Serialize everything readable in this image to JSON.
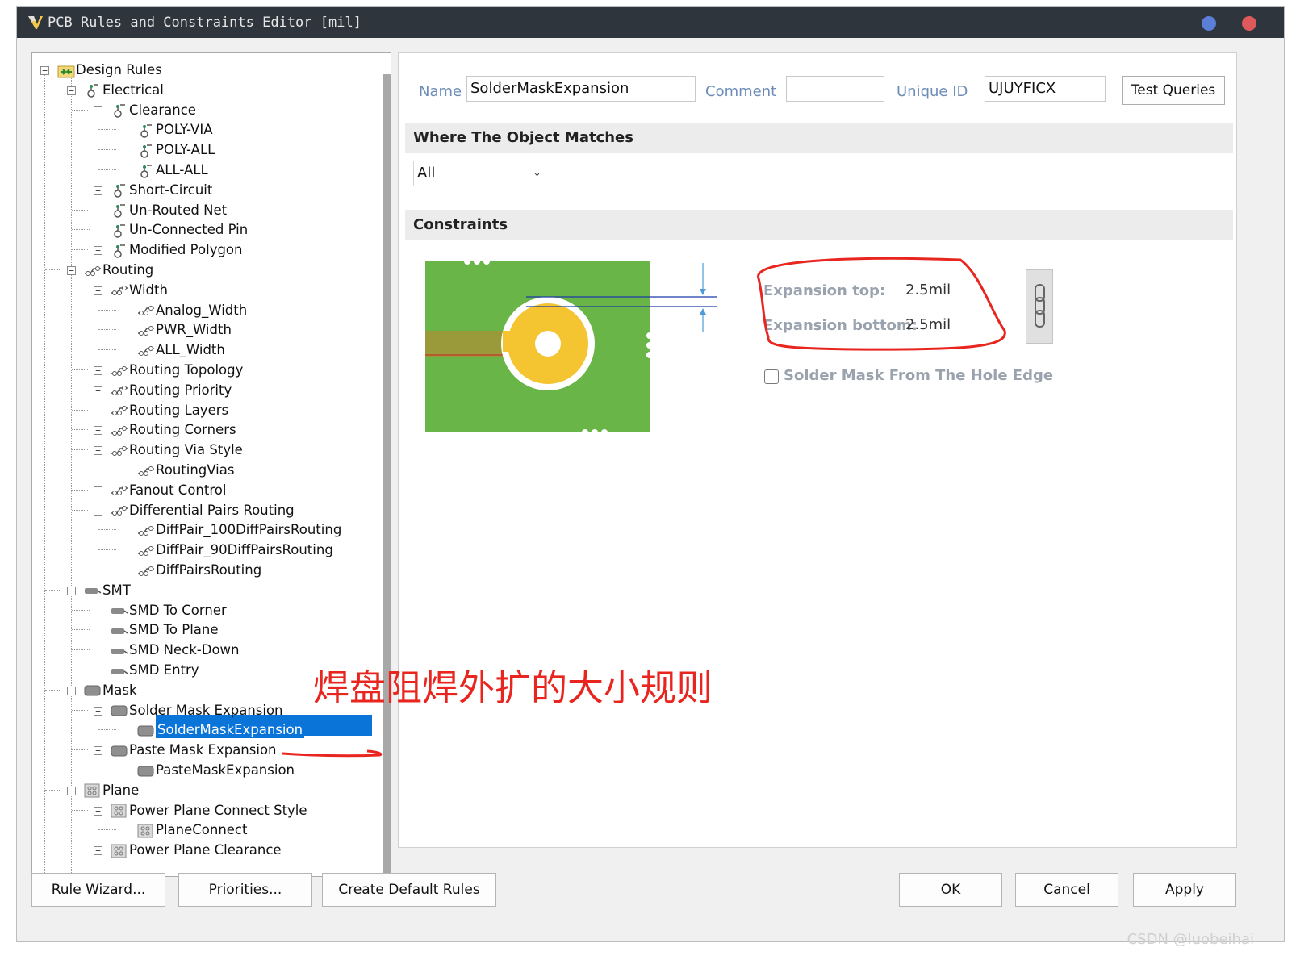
{
  "window": {
    "title": "PCB Rules and Constraints Editor [mil]"
  },
  "tree": {
    "items": [
      {
        "label": "Design Rules",
        "level": 0,
        "toggle": "−",
        "icon": "design-rules-icon"
      },
      {
        "label": "Electrical",
        "level": 1,
        "toggle": "−",
        "icon": "electrical-icon"
      },
      {
        "label": "Clearance",
        "level": 2,
        "toggle": "−",
        "icon": "clearance-icon"
      },
      {
        "label": "POLY-VIA",
        "level": 3,
        "toggle": "",
        "icon": "clearance-icon"
      },
      {
        "label": "POLY-ALL",
        "level": 3,
        "toggle": "",
        "icon": "clearance-icon"
      },
      {
        "label": "ALL-ALL",
        "level": 3,
        "toggle": "",
        "icon": "clearance-icon"
      },
      {
        "label": "Short-Circuit",
        "level": 2,
        "toggle": "+",
        "icon": "clearance-icon"
      },
      {
        "label": "Un-Routed Net",
        "level": 2,
        "toggle": "+",
        "icon": "clearance-icon"
      },
      {
        "label": "Un-Connected Pin",
        "level": 2,
        "toggle": "",
        "icon": "clearance-icon"
      },
      {
        "label": "Modified Polygon",
        "level": 2,
        "toggle": "+",
        "icon": "clearance-icon"
      },
      {
        "label": "Routing",
        "level": 1,
        "toggle": "−",
        "icon": "routing-icon"
      },
      {
        "label": "Width",
        "level": 2,
        "toggle": "−",
        "icon": "routing-icon"
      },
      {
        "label": "Analog_Width",
        "level": 3,
        "toggle": "",
        "icon": "routing-icon"
      },
      {
        "label": "PWR_Width",
        "level": 3,
        "toggle": "",
        "icon": "routing-icon"
      },
      {
        "label": "ALL_Width",
        "level": 3,
        "toggle": "",
        "icon": "routing-icon"
      },
      {
        "label": "Routing Topology",
        "level": 2,
        "toggle": "+",
        "icon": "routing-icon"
      },
      {
        "label": "Routing Priority",
        "level": 2,
        "toggle": "+",
        "icon": "routing-icon"
      },
      {
        "label": "Routing Layers",
        "level": 2,
        "toggle": "+",
        "icon": "routing-icon"
      },
      {
        "label": "Routing Corners",
        "level": 2,
        "toggle": "+",
        "icon": "routing-icon"
      },
      {
        "label": "Routing Via Style",
        "level": 2,
        "toggle": "−",
        "icon": "routing-icon"
      },
      {
        "label": "RoutingVias",
        "level": 3,
        "toggle": "",
        "icon": "routing-icon"
      },
      {
        "label": "Fanout Control",
        "level": 2,
        "toggle": "+",
        "icon": "routing-icon"
      },
      {
        "label": "Differential Pairs Routing",
        "level": 2,
        "toggle": "−",
        "icon": "routing-icon"
      },
      {
        "label": "DiffPair_100DiffPairsRouting",
        "level": 3,
        "toggle": "",
        "icon": "routing-icon"
      },
      {
        "label": "DiffPair_90DiffPairsRouting",
        "level": 3,
        "toggle": "",
        "icon": "routing-icon"
      },
      {
        "label": "DiffPairsRouting",
        "level": 3,
        "toggle": "",
        "icon": "routing-icon"
      },
      {
        "label": "SMT",
        "level": 1,
        "toggle": "−",
        "icon": "smt-icon"
      },
      {
        "label": "SMD To Corner",
        "level": 2,
        "toggle": "",
        "icon": "smt-icon"
      },
      {
        "label": "SMD To Plane",
        "level": 2,
        "toggle": "",
        "icon": "smt-icon"
      },
      {
        "label": "SMD Neck-Down",
        "level": 2,
        "toggle": "",
        "icon": "smt-icon"
      },
      {
        "label": "SMD Entry",
        "level": 2,
        "toggle": "",
        "icon": "smt-icon"
      },
      {
        "label": "Mask",
        "level": 1,
        "toggle": "−",
        "icon": "mask-icon"
      },
      {
        "label": "Solder Mask Expansion",
        "level": 2,
        "toggle": "−",
        "icon": "mask-icon"
      },
      {
        "label": "SolderMaskExpansion",
        "level": 3,
        "toggle": "",
        "icon": "mask-icon",
        "selected": true
      },
      {
        "label": "Paste Mask Expansion",
        "level": 2,
        "toggle": "−",
        "icon": "mask-icon"
      },
      {
        "label": "PasteMaskExpansion",
        "level": 3,
        "toggle": "",
        "icon": "mask-icon"
      },
      {
        "label": "Plane",
        "level": 1,
        "toggle": "−",
        "icon": "plane-icon"
      },
      {
        "label": "Power Plane Connect Style",
        "level": 2,
        "toggle": "−",
        "icon": "plane-icon"
      },
      {
        "label": "PlaneConnect",
        "level": 3,
        "toggle": "",
        "icon": "plane-icon"
      },
      {
        "label": "Power Plane Clearance",
        "level": 2,
        "toggle": "+",
        "icon": "plane-icon"
      }
    ]
  },
  "rule": {
    "name_label": "Name",
    "name_value": "SolderMaskExpansion",
    "comment_label": "Comment",
    "comment_value": "",
    "uid_label": "Unique ID",
    "uid_value": "UJUYFICX",
    "test_queries": "Test Queries"
  },
  "where": {
    "title": "Where The Object Matches",
    "selected": "All"
  },
  "constraints": {
    "title": "Constraints",
    "expansion_top_label": "Expansion top:",
    "expansion_top_value": "2.5mil",
    "expansion_bottom_label": "Expansion bottom:",
    "expansion_bottom_value": "2.5mil",
    "hole_edge_label": "Solder Mask From The Hole Edge",
    "hole_edge_checked": false
  },
  "annotation": {
    "text": "焊盘阻焊外扩的大小规则",
    "color": "#e8261f"
  },
  "footer": {
    "rule_wizard": "Rule Wizard...",
    "priorities": "Priorities...",
    "create_default": "Create Default Rules",
    "ok": "OK",
    "cancel": "Cancel",
    "apply": "Apply"
  },
  "watermark": "CSDN @luobeihai",
  "colors": {
    "titlebar": "#2f353d",
    "selection": "#0a74d8",
    "board_green": "#6ab547",
    "pad_yellow": "#f5c431",
    "trace_olive": "#9a9a3a"
  }
}
